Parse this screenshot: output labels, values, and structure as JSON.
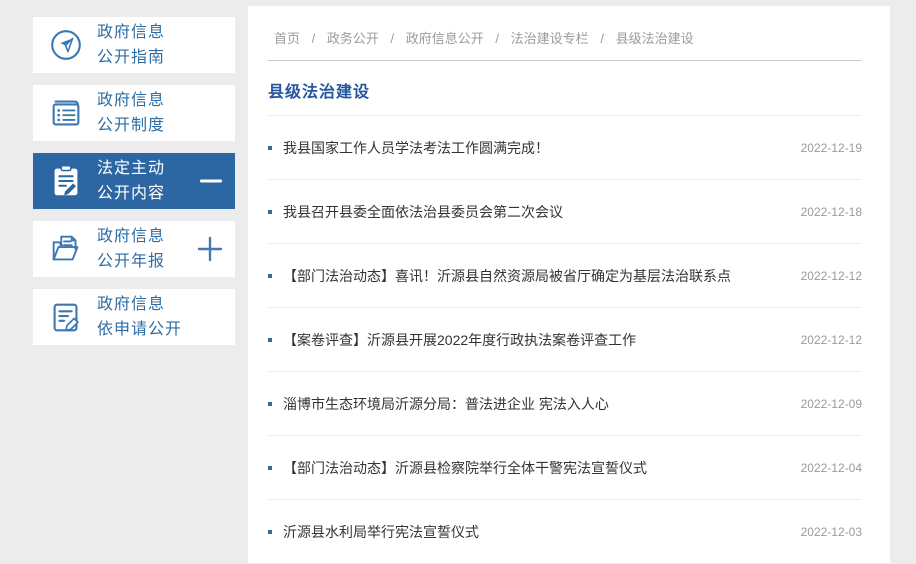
{
  "colors": {
    "page_background": "#ececec",
    "panel_background": "#ffffff",
    "accent_blue": "#2e6da4",
    "active_item_background": "#2d67a3",
    "title_blue": "#2456a0",
    "text_dark": "#333333",
    "text_muted": "#9b9b9b"
  },
  "sidebar": {
    "items": [
      {
        "line1": "政府信息",
        "line2": "公开指南",
        "icon": "compass-icon",
        "active": false,
        "toggle": ""
      },
      {
        "line1": "政府信息",
        "line2": "公开制度",
        "icon": "list-document-icon",
        "active": false,
        "toggle": ""
      },
      {
        "line1": "法定主动",
        "line2": "公开内容",
        "icon": "clipboard-pencil-icon",
        "active": true,
        "toggle": "minus"
      },
      {
        "line1": "政府信息",
        "line2": "公开年报",
        "icon": "folder-document-icon",
        "active": false,
        "toggle": "plus"
      },
      {
        "line1": "政府信息",
        "line2": "依申请公开",
        "icon": "document-pencil-icon",
        "active": false,
        "toggle": ""
      }
    ]
  },
  "breadcrumb": {
    "separator": "/",
    "items": [
      "首页",
      "政务公开",
      "政府信息公开",
      "法治建设专栏",
      "县级法治建设"
    ]
  },
  "main": {
    "title": "县级法治建设",
    "articles": [
      {
        "title": "我县国家工作人员学法考法工作圆满完成！",
        "date": "2022-12-19"
      },
      {
        "title": "我县召开县委全面依法治县委员会第二次会议",
        "date": "2022-12-18"
      },
      {
        "title": "【部门法治动态】喜讯！沂源县自然资源局被省厅确定为基层法治联系点",
        "date": "2022-12-12"
      },
      {
        "title": "【案卷评查】沂源县开展2022年度行政执法案卷评查工作",
        "date": "2022-12-12"
      },
      {
        "title": "淄博市生态环境局沂源分局：普法进企业 宪法入人心",
        "date": "2022-12-09"
      },
      {
        "title": "【部门法治动态】沂源县检察院举行全体干警宪法宣誓仪式",
        "date": "2022-12-04"
      },
      {
        "title": "沂源县水利局举行宪法宣誓仪式",
        "date": "2022-12-03"
      }
    ]
  }
}
